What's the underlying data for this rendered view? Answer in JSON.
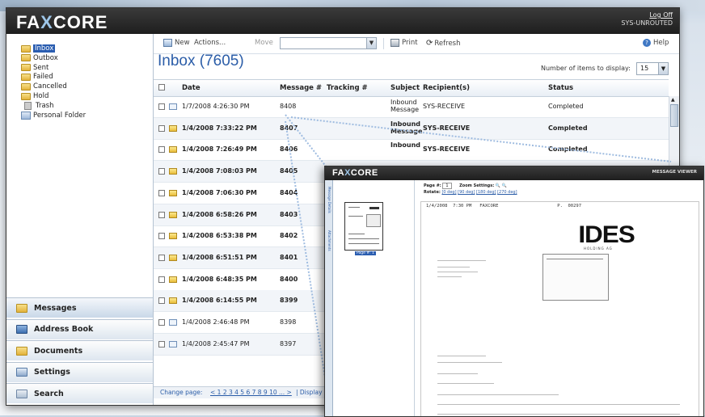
{
  "app": {
    "logo": "FAXCORE",
    "logo_prefix": "FA",
    "logo_x": "X",
    "logo_suffix": "CORE",
    "logoff_label": "Log Off",
    "user": "SYS-UNROUTED"
  },
  "folders": [
    {
      "label": "Inbox",
      "selected": true
    },
    {
      "label": "Outbox"
    },
    {
      "label": "Sent"
    },
    {
      "label": "Failed"
    },
    {
      "label": "Cancelled"
    },
    {
      "label": "Hold"
    },
    {
      "label": "Trash"
    },
    {
      "label": "Personal Folder"
    }
  ],
  "nav": [
    "Messages",
    "Address Book",
    "Documents",
    "Settings",
    "Search"
  ],
  "toolbar": {
    "new_label": "New",
    "actions_label": "Actions...",
    "move_label": "Move",
    "print_label": "Print",
    "refresh_label": "Refresh",
    "help_label": "Help"
  },
  "inbox": {
    "title": "Inbox (7605)",
    "items_label": "Number of items to display:",
    "items_value": "15"
  },
  "grid": {
    "columns": [
      "Date",
      "Message #",
      "Tracking #",
      "Subject",
      "Recipient(s)",
      "Status"
    ],
    "rows": [
      {
        "date": "1/7/2008 4:26:30 PM",
        "msg": "8408",
        "subject": "Inbound Message",
        "recipient": "SYS-RECEIVE",
        "status": "Completed",
        "unread": false
      },
      {
        "date": "1/4/2008 7:33:22 PM",
        "msg": "8407",
        "subject": "Inbound Message",
        "recipient": "SYS-RECEIVE",
        "status": "Completed",
        "unread": true
      },
      {
        "date": "1/4/2008 7:26:49 PM",
        "msg": "8406",
        "subject": "Inbound",
        "recipient": "SYS-RECEIVE",
        "status": "Completed",
        "unread": true
      },
      {
        "date": "1/4/2008 7:08:03 PM",
        "msg": "8405",
        "unread": true
      },
      {
        "date": "1/4/2008 7:06:30 PM",
        "msg": "8404",
        "unread": true
      },
      {
        "date": "1/4/2008 6:58:26 PM",
        "msg": "8403",
        "unread": true
      },
      {
        "date": "1/4/2008 6:53:38 PM",
        "msg": "8402",
        "unread": true
      },
      {
        "date": "1/4/2008 6:51:51 PM",
        "msg": "8401",
        "unread": true
      },
      {
        "date": "1/4/2008 6:48:35 PM",
        "msg": "8400",
        "unread": true
      },
      {
        "date": "1/4/2008 6:14:55 PM",
        "msg": "8399",
        "unread": true
      },
      {
        "date": "1/4/2008 2:46:48 PM",
        "msg": "8398",
        "unread": false
      },
      {
        "date": "1/4/2008 2:45:47 PM",
        "msg": "8397",
        "unread": false
      }
    ]
  },
  "footer": {
    "change_page": "Change page:",
    "pages": "< 1 2 3 4 5 6 7 8 9 10 ... >",
    "displayed": "| Display"
  },
  "viewer": {
    "logo_prefix": "FA",
    "logo_x": "X",
    "logo_suffix": "CORE",
    "title": "MESSAGE VIEWER",
    "side_tabs": [
      "Message Details",
      "Attachments"
    ],
    "page_label": "Page #:",
    "page_value": "1",
    "zoom_label": "Zoom Settings:",
    "rotate_label": "Rotate:",
    "rotate_options": [
      "[0 deg]",
      "[90 deg]",
      "[180 deg]",
      "[270 deg]"
    ],
    "thumb_caption": "Page #: 1",
    "doc_header": "1/4/2008  7:30 PM   FAXCORE                      P.  00297",
    "doc_logo": "IDES",
    "doc_logo_sub": "HOLDING AG"
  },
  "colors": {
    "title_blue": "#2b5da8",
    "topbar": "#1e1e1e",
    "unread_envelope": "#e9bd3a",
    "selection": "#2a5db0"
  }
}
